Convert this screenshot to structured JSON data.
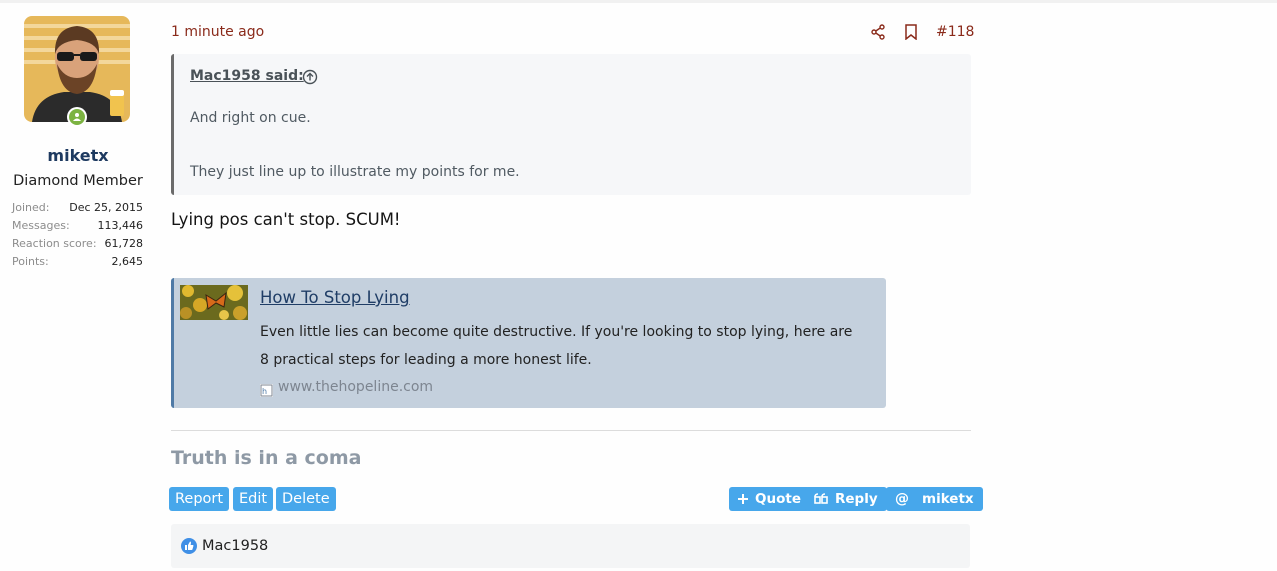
{
  "user": {
    "name": "miketx",
    "title": "Diamond Member",
    "stats": [
      {
        "label": "Joined:",
        "value": "Dec 25, 2015"
      },
      {
        "label": "Messages:",
        "value": "113,446"
      },
      {
        "label": "Reaction score:",
        "value": "61,728"
      },
      {
        "label": "Points:",
        "value": "2,645"
      }
    ]
  },
  "post": {
    "time": "1 minute ago",
    "number": "#118",
    "quote": {
      "author": "Mac1958 said:",
      "line1": "And right on cue.",
      "line2": "They just line up to illustrate my points for me."
    },
    "body": "Lying pos can't stop. SCUM!",
    "unfurl": {
      "title": "How To Stop Lying",
      "description": "Even little lies can become quite destructive. If you're looking to stop lying, here are 8 practical steps for leading a more honest life.",
      "domain": "www.thehopeline.com"
    },
    "signature": "Truth is in a coma"
  },
  "actions": {
    "report": "Report",
    "edit": "Edit",
    "delete": "Delete",
    "quote": "Quote",
    "reply": "Reply",
    "mention": "miketx"
  },
  "reactions": {
    "users": "Mac1958"
  },
  "colors": {
    "accent": "#47a7eb",
    "time_link": "#8a2a1a",
    "username": "#1e3a60",
    "online": "#7cb342"
  }
}
